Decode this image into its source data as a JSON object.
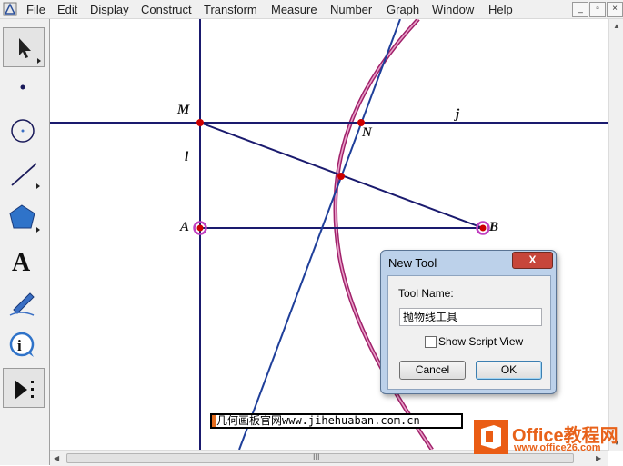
{
  "menubar": {
    "items": [
      "File",
      "Edit",
      "Display",
      "Construct",
      "Transform",
      "Measure",
      "Number",
      "Graph",
      "Window",
      "Help"
    ],
    "window_buttons": [
      "_",
      "▫",
      "×"
    ]
  },
  "toolbox": {
    "tools": [
      "arrow-select-tool",
      "point-tool",
      "compass-tool",
      "straightedge-tool",
      "polygon-tool",
      "text-tool",
      "marker-tool",
      "information-tool",
      "custom-tool"
    ],
    "text_tool_glyph": "A"
  },
  "canvas": {
    "labels": {
      "M": "M",
      "N": "N",
      "j": "j",
      "l": "l",
      "A": "A",
      "B": "B"
    },
    "colors": {
      "line": "#1a1a6e",
      "point": "#cc0000",
      "locus_outer": "#a0206a",
      "locus_inner": "#e8a0c8",
      "point_halo": "#c040c0"
    }
  },
  "dialog": {
    "title": "New Tool",
    "close_label": "X",
    "tool_name_label": "Tool Name:",
    "tool_name_value": "抛物线工具",
    "show_script_label": "Show Script View",
    "show_script_checked": false,
    "cancel_label": "Cancel",
    "ok_label": "OK"
  },
  "watermark": {
    "text": "几何画板官网www.jihehuaban.com.cn"
  },
  "logo": {
    "title": "Office教程网",
    "url": "www.office26.com"
  },
  "scrollbar": {
    "grip": "III"
  }
}
